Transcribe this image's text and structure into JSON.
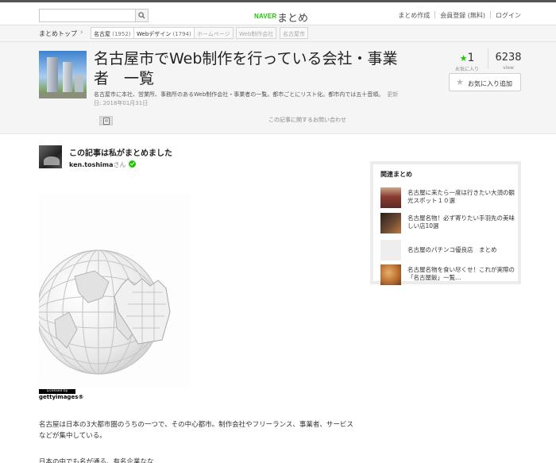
{
  "topbar": {
    "search_placeholder": "",
    "logo_naver": "NAVER",
    "logo_matome": "まとめ",
    "links": [
      "まとめ作成",
      "会員登録 (無料)",
      "ログイン"
    ]
  },
  "breadcrumb": {
    "home": "まとめトップ",
    "arrow": "›",
    "tags": [
      {
        "label": "名古屋",
        "count": "(1952)"
      },
      {
        "label": "Webデザイン",
        "count": "(1794)"
      },
      {
        "label": "ホームページ",
        "count": ""
      },
      {
        "label": "Web制作会社",
        "count": ""
      },
      {
        "label": "名古屋市",
        "count": ""
      }
    ]
  },
  "article": {
    "title": "名古屋市でWeb制作を行っている会社・事業者　一覧",
    "description": "名古屋市に本社、営業所、事務所のあるWeb制作会社・事業者の一覧。都市ごとにリスト化。都市内では五十音順。",
    "updated": "更新日: 2018年01月31日",
    "fav_count": "1",
    "fav_label": "お気に入り",
    "views": "6238",
    "views_label": "view",
    "fav_button": "お気に入り追加",
    "inquiry": "この記事に関するお問い合わせ"
  },
  "author": {
    "heading": "この記事は私がまとめました",
    "name": "ken.toshima",
    "suffix": "さん"
  },
  "image_credit": {
    "licensed": "Licensed by",
    "getty": "gettyimages®"
  },
  "body": {
    "para1": "名古屋は日本の3大都市圏のうちの一つで、その中心都市。制作会社やフリーランス、事業者、サービスなどが集中している。",
    "para2": "日本の中でも名が通る、有名企業なな"
  },
  "related": {
    "heading": "関連まとめ",
    "items": [
      {
        "title": "名古屋に来たら一度は行きたい大須の観光スポット１０選",
        "thumb_color": "#8a3b32"
      },
      {
        "title": "名古屋名物！必ず寄りたい手羽先の美味しい店10選",
        "thumb_color": "#5a3a2a"
      },
      {
        "title": "名古屋のパチンコ優良店　まとめ",
        "thumb_color": "#eeeeee"
      },
      {
        "title": "名古屋名物を食い尽くせ！これが実際の「名古屋飯」一覧…",
        "thumb_color": "#b56a2e"
      }
    ]
  },
  "colors": {
    "brand_green": "#1ec800",
    "header_bg": "#f5f5f5"
  }
}
